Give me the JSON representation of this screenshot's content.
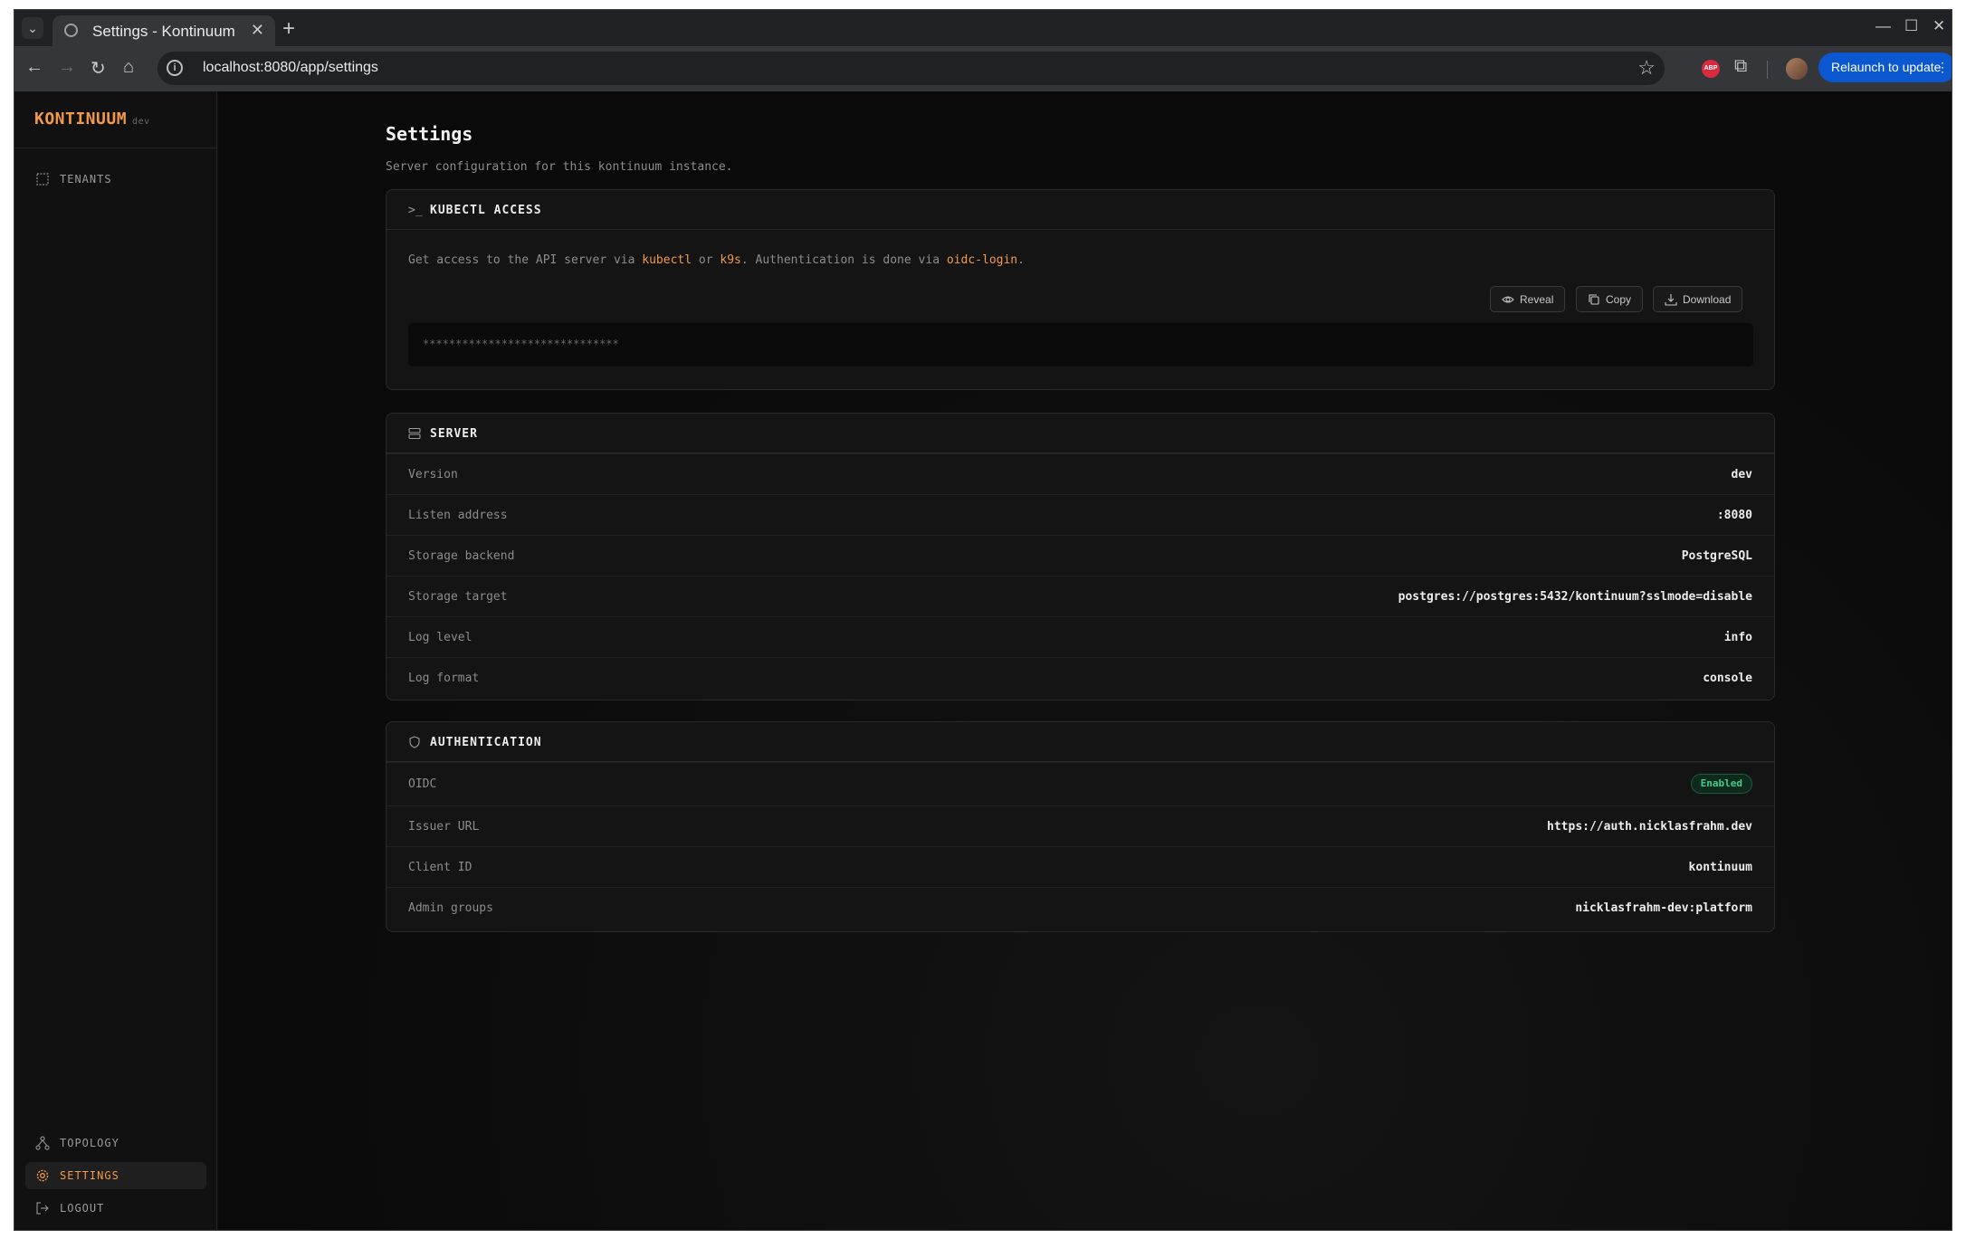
{
  "browser": {
    "tab_title": "Settings - Kontinuum",
    "url": "localhost:8080/app/settings",
    "relaunch_label": "Relaunch to update",
    "abp_label": "ABP"
  },
  "brand": {
    "name": "KONTINUUM",
    "env": "dev"
  },
  "sidebar": {
    "top_items": [
      {
        "label": "TENANTS",
        "icon": "tenants-icon"
      }
    ],
    "bottom_items": [
      {
        "label": "TOPOLOGY",
        "icon": "topology-icon",
        "active": false
      },
      {
        "label": "SETTINGS",
        "icon": "gear-icon",
        "active": true
      },
      {
        "label": "LOGOUT",
        "icon": "logout-icon",
        "active": false
      }
    ]
  },
  "page": {
    "title": "Settings",
    "subtitle": "Server configuration for this kontinuum instance."
  },
  "kubectl": {
    "title": "KUBECTL ACCESS",
    "desc_1": "Get access to the API server via ",
    "link_kubectl": "kubectl",
    "desc_2": " or ",
    "link_k9s": "k9s",
    "desc_3": ". Authentication is done via ",
    "link_oidc": "oidc-login",
    "desc_4": ".",
    "reveal_label": "Reveal",
    "copy_label": "Copy",
    "download_label": "Download",
    "token_masked": "******************************"
  },
  "server": {
    "title": "SERVER",
    "rows": [
      {
        "key": "Version",
        "value": "dev"
      },
      {
        "key": "Listen address",
        "value": ":8080"
      },
      {
        "key": "Storage backend",
        "value": "PostgreSQL"
      },
      {
        "key": "Storage target",
        "value": "postgres://postgres:5432/kontinuum?sslmode=disable"
      },
      {
        "key": "Log level",
        "value": "info"
      },
      {
        "key": "Log format",
        "value": "console"
      }
    ]
  },
  "auth": {
    "title": "AUTHENTICATION",
    "oidc_label": "OIDC",
    "oidc_status": "Enabled",
    "rows": [
      {
        "key": "Issuer URL",
        "value": "https://auth.nicklasfrahm.dev"
      },
      {
        "key": "Client ID",
        "value": "kontinuum"
      },
      {
        "key": "Admin groups",
        "value": "nicklasfrahm-dev:platform"
      }
    ]
  },
  "colors": {
    "accent": "#f2994a",
    "success": "#3ecf8e",
    "chrome_blue": "#0b57d0"
  }
}
